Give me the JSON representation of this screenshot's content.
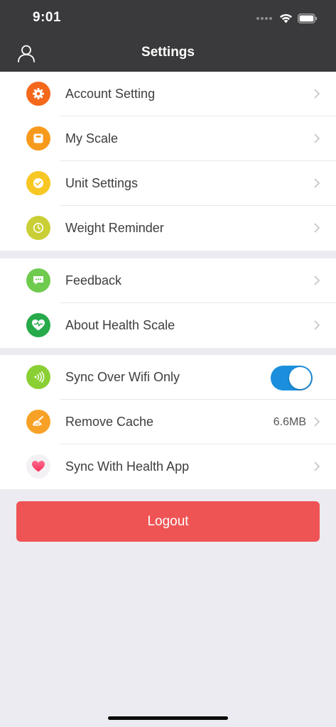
{
  "status_bar": {
    "time": "9:01"
  },
  "nav": {
    "title": "Settings",
    "left_icon": "profile-icon"
  },
  "colors": {
    "header": "#3a393b",
    "background": "#ecebf1",
    "toggle_on": "#1b8fdc",
    "logout": "#ef5454"
  },
  "groups": [
    {
      "items": [
        {
          "label": "Account Setting",
          "icon": "gear-icon",
          "color": "#f4681c"
        },
        {
          "label": "My Scale",
          "icon": "scale-icon",
          "color": "#f79a1c"
        },
        {
          "label": "Unit Settings",
          "icon": "check-circle-icon",
          "color": "#f7c724"
        },
        {
          "label": "Weight Reminder",
          "icon": "clock-icon",
          "color": "#c9cf34"
        }
      ]
    },
    {
      "items": [
        {
          "label": "Feedback",
          "icon": "chat-bubble-icon",
          "color": "#6fcb4e"
        },
        {
          "label": "About Health Scale",
          "icon": "heart-icon",
          "color": "#27aa4a"
        }
      ]
    },
    {
      "items": [
        {
          "label": "Sync Over Wifi Only",
          "icon": "wifi-signal-icon",
          "color": "#8acf33",
          "toggle": true
        },
        {
          "label": "Remove Cache",
          "icon": "broom-icon",
          "color": "#f7a226",
          "value": "6.6MB"
        },
        {
          "label": "Sync With Health App",
          "icon": "health-app-icon",
          "color": "#f3f1f4"
        }
      ]
    }
  ],
  "logout_label": "Logout"
}
